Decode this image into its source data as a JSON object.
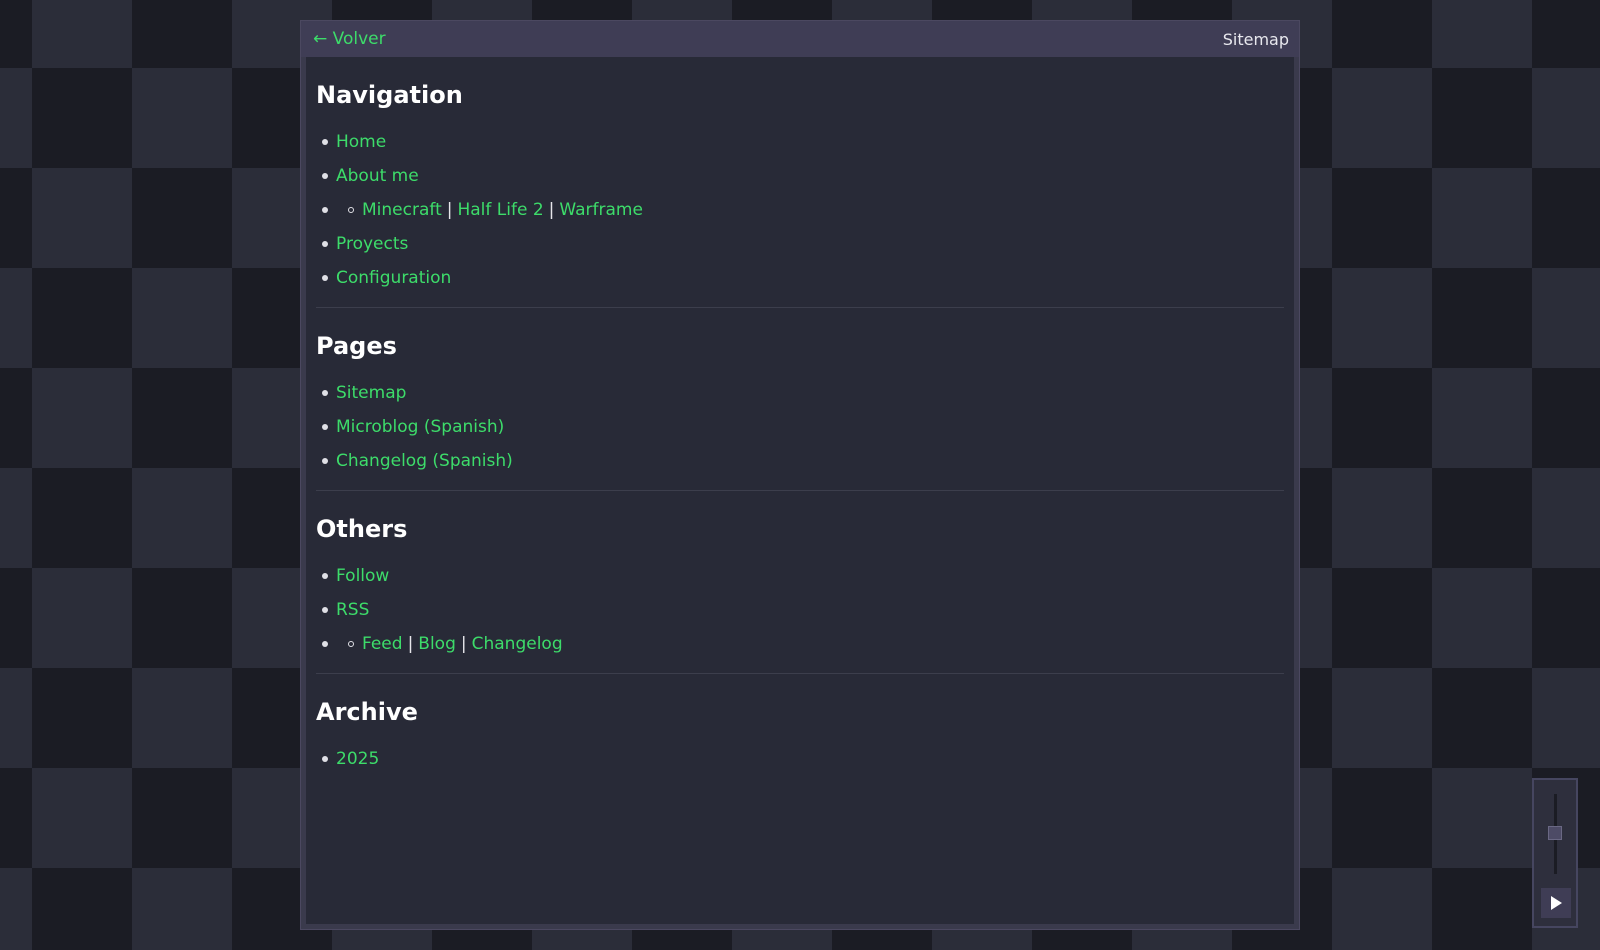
{
  "titlebar": {
    "back_label": "← Volver",
    "title": "Sitemap"
  },
  "sections": {
    "navigation": {
      "heading": "Navigation",
      "items": {
        "home": "Home",
        "about": "About me",
        "sub": {
          "minecraft": "Minecraft",
          "halflife": "Half Life 2",
          "warframe": "Warframe"
        },
        "proyects": "Proyects",
        "configuration": "Configuration"
      }
    },
    "pages": {
      "heading": "Pages",
      "items": {
        "sitemap": "Sitemap",
        "microblog": "Microblog (Spanish)",
        "changelog": "Changelog (Spanish)"
      }
    },
    "others": {
      "heading": "Others",
      "items": {
        "follow": "Follow",
        "rss": "RSS",
        "sub": {
          "feed": "Feed",
          "blog": "Blog",
          "changelog": "Changelog"
        }
      }
    },
    "archive": {
      "heading": "Archive",
      "items": {
        "y2025": "2025"
      }
    }
  },
  "separator": "|",
  "icons": {
    "play": "play-icon"
  },
  "colors": {
    "link": "#3ddc6a",
    "titlebar": "#3f3d55",
    "background": "#282a37"
  }
}
